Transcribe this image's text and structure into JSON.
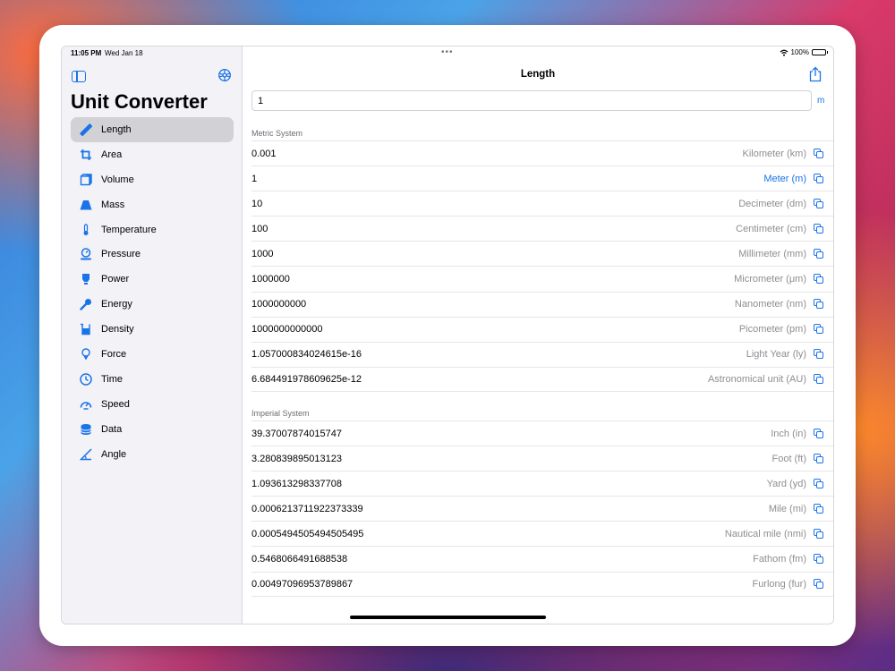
{
  "status_bar": {
    "time": "11:05 PM",
    "date": "Wed Jan 18",
    "battery": "100%"
  },
  "sidebar": {
    "title": "Unit Converter",
    "items": [
      {
        "label": "Length",
        "icon": "ruler-icon",
        "selected": true
      },
      {
        "label": "Area",
        "icon": "crop-icon"
      },
      {
        "label": "Volume",
        "icon": "cube-icon"
      },
      {
        "label": "Mass",
        "icon": "scale-icon"
      },
      {
        "label": "Temperature",
        "icon": "thermometer-icon"
      },
      {
        "label": "Pressure",
        "icon": "gauge-icon"
      },
      {
        "label": "Power",
        "icon": "bulb-icon"
      },
      {
        "label": "Energy",
        "icon": "wrench-icon"
      },
      {
        "label": "Density",
        "icon": "beaker-icon"
      },
      {
        "label": "Force",
        "icon": "force-icon"
      },
      {
        "label": "Time",
        "icon": "clock-icon"
      },
      {
        "label": "Speed",
        "icon": "speedometer-icon"
      },
      {
        "label": "Data",
        "icon": "database-icon"
      },
      {
        "label": "Angle",
        "icon": "angle-icon"
      }
    ]
  },
  "main": {
    "title": "Length",
    "input": {
      "value": "1",
      "unit": "m"
    },
    "metric": {
      "heading": "Metric System",
      "rows": [
        {
          "value": "0.001",
          "unit": "Kilometer (km)"
        },
        {
          "value": "1",
          "unit": "Meter (m)",
          "active": true
        },
        {
          "value": "10",
          "unit": "Decimeter (dm)"
        },
        {
          "value": "100",
          "unit": "Centimeter (cm)"
        },
        {
          "value": "1000",
          "unit": "Millimeter (mm)"
        },
        {
          "value": "1000000",
          "unit": "Micrometer (μm)"
        },
        {
          "value": "1000000000",
          "unit": "Nanometer (nm)"
        },
        {
          "value": "1000000000000",
          "unit": "Picometer (pm)"
        },
        {
          "value": "1.057000834024615e-16",
          "unit": "Light Year (ly)"
        },
        {
          "value": "6.684491978609625e-12",
          "unit": "Astronomical unit (AU)"
        }
      ]
    },
    "imperial": {
      "heading": "Imperial System",
      "rows": [
        {
          "value": "39.37007874015747",
          "unit": "Inch (in)"
        },
        {
          "value": "3.280839895013123",
          "unit": "Foot (ft)"
        },
        {
          "value": "1.093613298337708",
          "unit": "Yard (yd)"
        },
        {
          "value": "0.0006213711922373339",
          "unit": "Mile (mi)"
        },
        {
          "value": "0.0005494505494505495",
          "unit": "Nautical mile (nmi)"
        },
        {
          "value": "0.5468066491688538",
          "unit": "Fathom (fm)"
        },
        {
          "value": "0.00497096953789867",
          "unit": "Furlong (fur)"
        }
      ]
    }
  },
  "colors": {
    "accent": "#1a73e8",
    "sidebar_bg": "#f2f2f7",
    "selected_bg": "#d1d1d6"
  }
}
